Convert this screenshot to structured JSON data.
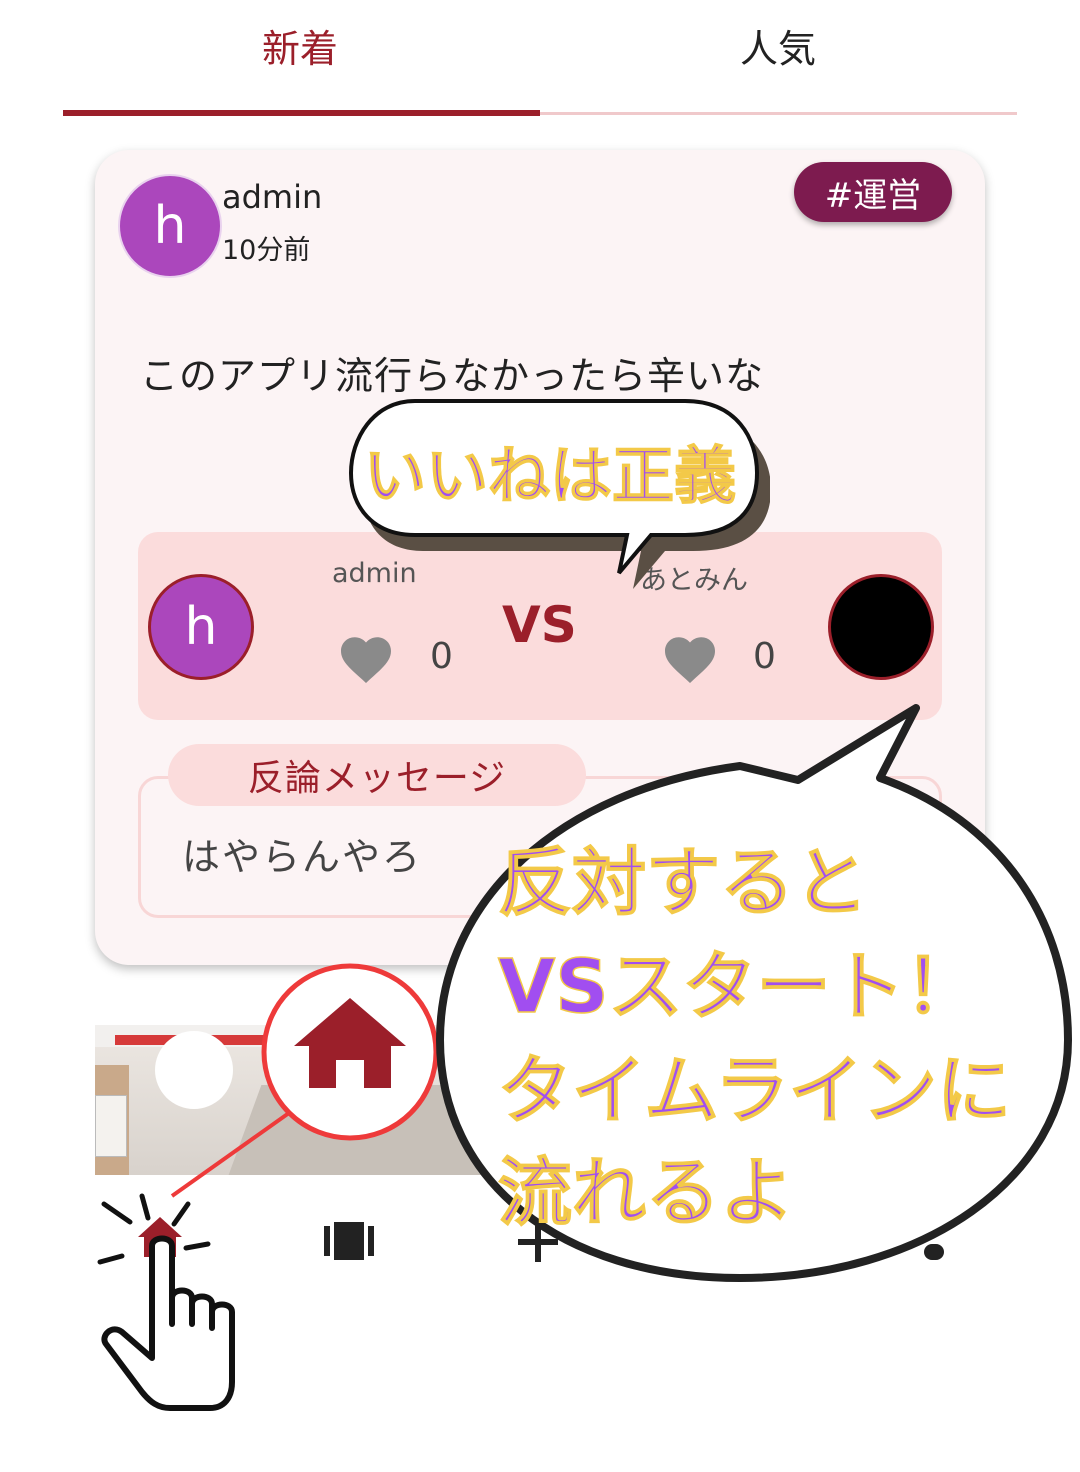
{
  "tabs": {
    "new": "新着",
    "popular": "人気"
  },
  "post": {
    "author": "admin",
    "time": "10分前",
    "avatar_letter": "h",
    "tag": "#運営",
    "body": "このアプリ流行らなかったら辛いな"
  },
  "vs": {
    "left_name": "admin",
    "left_avatar_letter": "h",
    "vs_label": "VS",
    "left_likes": "0",
    "right_name": "あとみん",
    "right_likes": "0"
  },
  "rebuttal": {
    "label": "反論メッセージ",
    "text": "はやらんやろ"
  },
  "callouts": {
    "top": "いいねは正義",
    "big_line1": "反対すると",
    "big_line2": "VSスタート！",
    "big_line3": "タイムラインに",
    "big_line4": "流れるよ"
  },
  "colors": {
    "accent": "#9b1f2a",
    "tag": "#7d1b4f",
    "avatar": "#ab47bc",
    "callout_text": "#a14ef0"
  },
  "icons": [
    "home-icon",
    "heart-icon",
    "card-stack-icon",
    "plus-icon",
    "pointing-hand-icon"
  ]
}
